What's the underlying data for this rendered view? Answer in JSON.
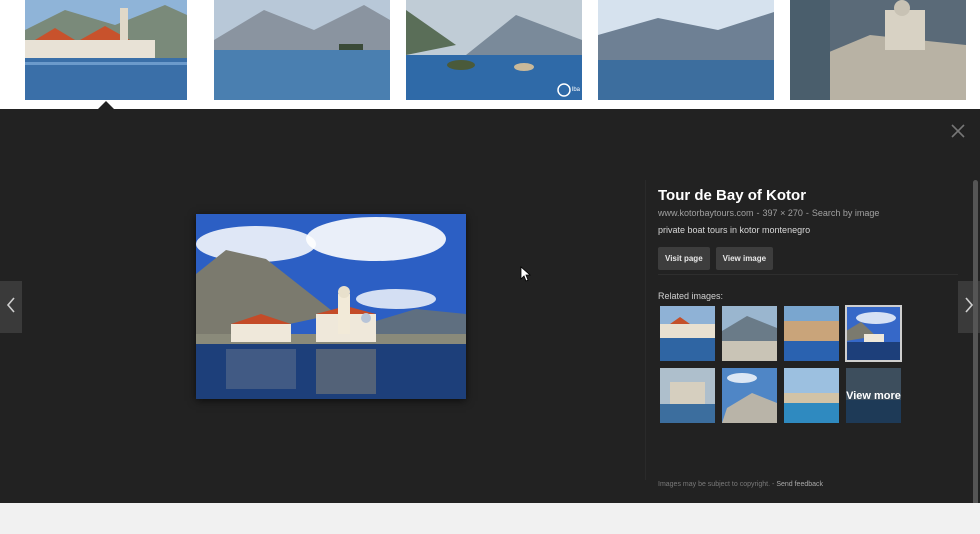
{
  "strip": {
    "thumbnails": [
      {
        "name": "perast-town"
      },
      {
        "name": "bay-islands-mountains"
      },
      {
        "name": "bay-islets-watermark",
        "watermark": "lba"
      },
      {
        "name": "bay-wide-view"
      },
      {
        "name": "island-church-aerial"
      }
    ]
  },
  "viewer": {
    "title": "Tour de Bay of Kotor",
    "domain": "www.kotorbaytours.com",
    "dimensions": "397 × 270",
    "search_by_image": "Search by image",
    "description": "private boat tours in kotor montenegro",
    "visit_page": "Visit page",
    "view_image": "View image",
    "related_label": "Related images:",
    "view_more": "View more",
    "footer_copyright": "Images may be subject to copyright.",
    "footer_dash": "-",
    "send_feedback": "Send feedback",
    "separator": "-"
  },
  "colors": {
    "panel": "#222222",
    "page": "#f1f1f1"
  }
}
